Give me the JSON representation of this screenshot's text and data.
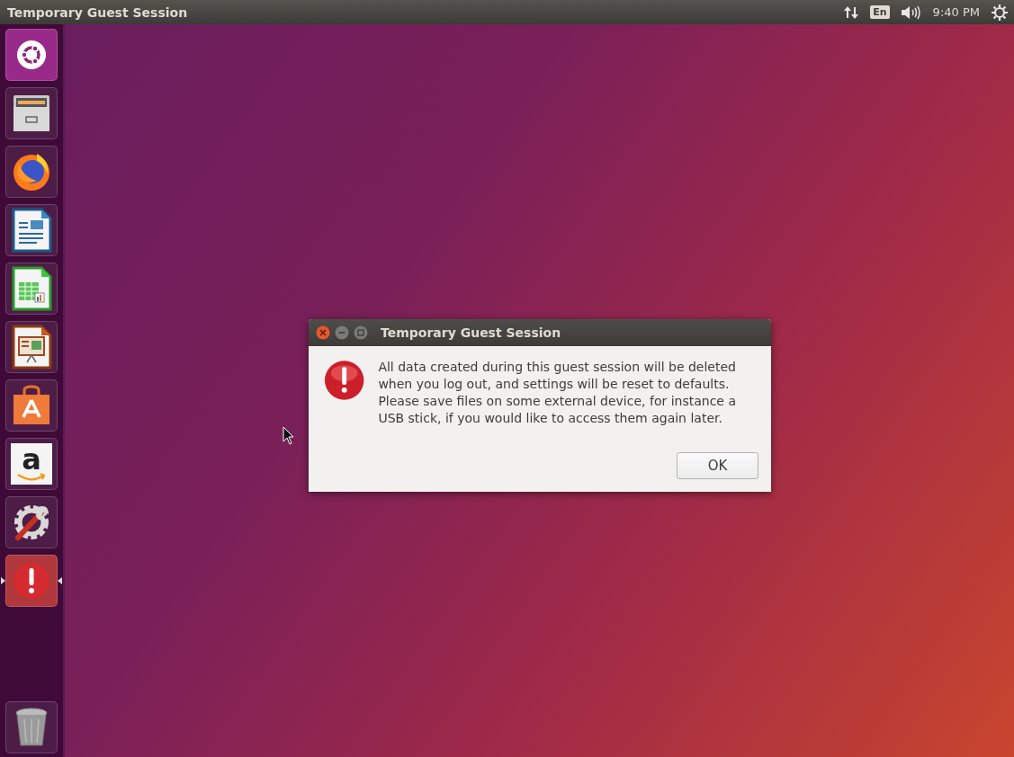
{
  "top_bar": {
    "title": "Temporary Guest Session",
    "keyboard_layout": "En",
    "clock": "9:40 PM"
  },
  "launcher": {
    "items": [
      {
        "kind": "dash",
        "active": false
      },
      {
        "kind": "files",
        "active": false
      },
      {
        "kind": "browser",
        "active": false
      },
      {
        "kind": "writer",
        "active": false
      },
      {
        "kind": "calc",
        "active": false
      },
      {
        "kind": "impress",
        "active": false
      },
      {
        "kind": "store",
        "active": false
      },
      {
        "kind": "amazon",
        "glyph": "a",
        "active": false
      },
      {
        "kind": "settings",
        "active": false
      },
      {
        "kind": "alert",
        "active": true
      }
    ],
    "trash": {
      "kind": "trash"
    }
  },
  "dialog": {
    "title": "Temporary Guest Session",
    "message": "All data created during this guest session will be deleted when you log out, and settings will be reset to defaults. Please save files on some external device, for instance a USB stick, if you would like to access them again later.",
    "buttons": [
      "OK"
    ]
  }
}
